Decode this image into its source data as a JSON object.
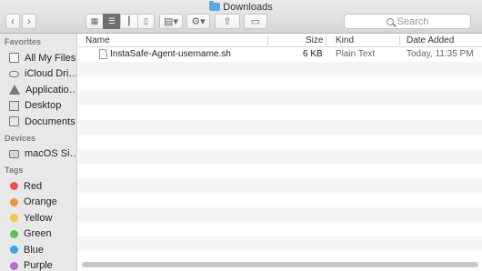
{
  "window": {
    "title": "Downloads"
  },
  "toolbar": {
    "back_icon": "chevron-left-icon",
    "forward_icon": "chevron-right-icon",
    "view_buttons": [
      "icon-view",
      "list-view",
      "column-view",
      "cover-flow-view"
    ],
    "active_view": "list-view",
    "search_placeholder": "Search"
  },
  "sidebar": {
    "favorites_header": "Favorites",
    "favorites": [
      {
        "label": "All My Files",
        "icon": "all-files-icon"
      },
      {
        "label": "iCloud Dri…",
        "icon": "cloud-icon"
      },
      {
        "label": "Applicatio…",
        "icon": "applications-icon"
      },
      {
        "label": "Desktop",
        "icon": "desktop-icon"
      },
      {
        "label": "Documents",
        "icon": "documents-icon"
      }
    ],
    "devices_header": "Devices",
    "devices": [
      {
        "label": "macOS Si…",
        "icon": "disk-icon"
      }
    ],
    "tags_header": "Tags",
    "tags": [
      {
        "label": "Red",
        "color": "#ec5050"
      },
      {
        "label": "Orange",
        "color": "#f0943c"
      },
      {
        "label": "Yellow",
        "color": "#f4c83a"
      },
      {
        "label": "Green",
        "color": "#5cc44c"
      },
      {
        "label": "Blue",
        "color": "#37a6ee"
      },
      {
        "label": "Purple",
        "color": "#b76bd6"
      }
    ]
  },
  "table": {
    "columns": {
      "name": "Name",
      "size": "Size",
      "kind": "Kind",
      "date": "Date Added"
    },
    "rows": [
      {
        "name": "InstaSafe-Agent-username.sh",
        "size": "6 KB",
        "kind": "Plain Text",
        "date": "Today, 11:35 PM"
      }
    ]
  }
}
